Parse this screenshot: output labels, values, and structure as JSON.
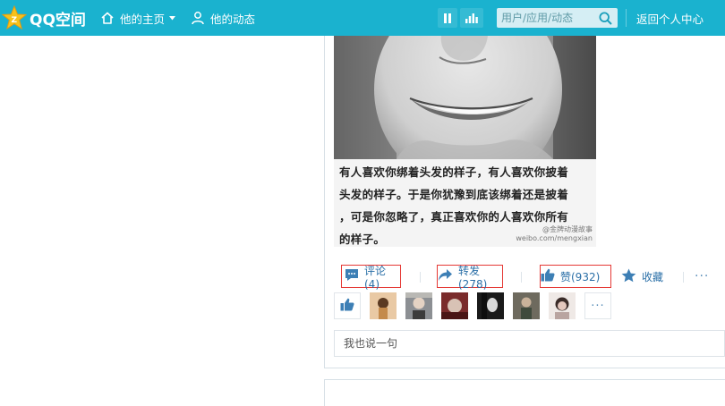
{
  "header": {
    "brand": "QQ空间",
    "nav_home": "他的主页",
    "nav_feed": "他的动态",
    "search_placeholder": "用户/应用/动态",
    "back_to_center": "返回个人中心"
  },
  "post": {
    "caption_lines": [
      "有人喜欢你绑着头发的样子，有人喜欢你披着",
      "头发的样子。于是你犹豫到底该绑着还是披着",
      "，可是你忽略了，真正喜欢你的人喜欢你所有",
      "的样子。"
    ],
    "watermark_line1": "@金牌动漫故事",
    "watermark_line2": "weibo.com/mengxian"
  },
  "actions": {
    "comment_label": "评论(4)",
    "share_label": "转发(278)",
    "like_label": "赞(932)",
    "favorite_label": "收藏",
    "more_label": "···"
  },
  "comment": {
    "placeholder": "我也说一句"
  },
  "colors": {
    "header_bg": "#1ab2cf",
    "link_blue": "#2a6fa7",
    "highlight_red": "#e53935"
  }
}
